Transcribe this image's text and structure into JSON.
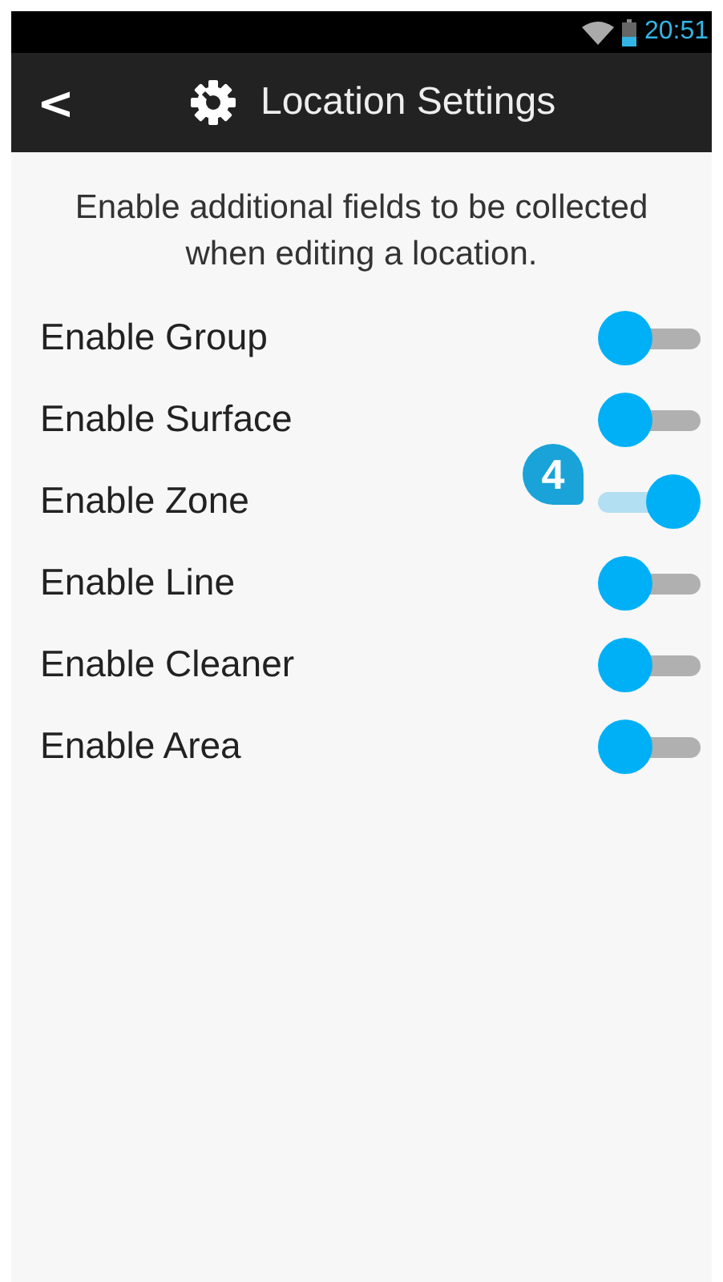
{
  "status_bar": {
    "time": "20:51"
  },
  "app_bar": {
    "back": "<",
    "title": "Location Settings"
  },
  "intro": "Enable additional fields to be collected when editing a location.",
  "settings": [
    {
      "label": "Enable Group",
      "on": false
    },
    {
      "label": "Enable Surface",
      "on": false
    },
    {
      "label": "Enable Zone",
      "on": true,
      "callout": "4"
    },
    {
      "label": "Enable Line",
      "on": false
    },
    {
      "label": "Enable Cleaner",
      "on": false
    },
    {
      "label": "Enable Area",
      "on": false
    }
  ]
}
